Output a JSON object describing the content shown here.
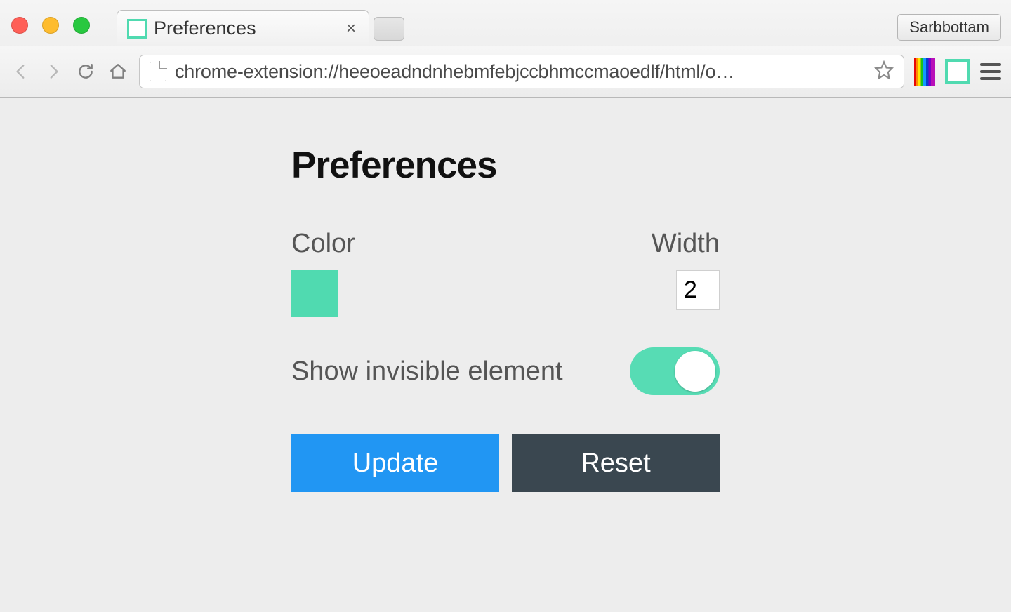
{
  "browser": {
    "tab_title": "Preferences",
    "url": "chrome-extension://heeoeadndnhebmfebjccbhmccmaoedlf/html/o…",
    "profile_name": "Sarbbottam"
  },
  "page": {
    "title": "Preferences",
    "color": {
      "label": "Color",
      "value": "#50dab0"
    },
    "width": {
      "label": "Width",
      "value": "2"
    },
    "show_invisible": {
      "label": "Show invisible element",
      "enabled": true
    },
    "buttons": {
      "update": "Update",
      "reset": "Reset"
    }
  }
}
